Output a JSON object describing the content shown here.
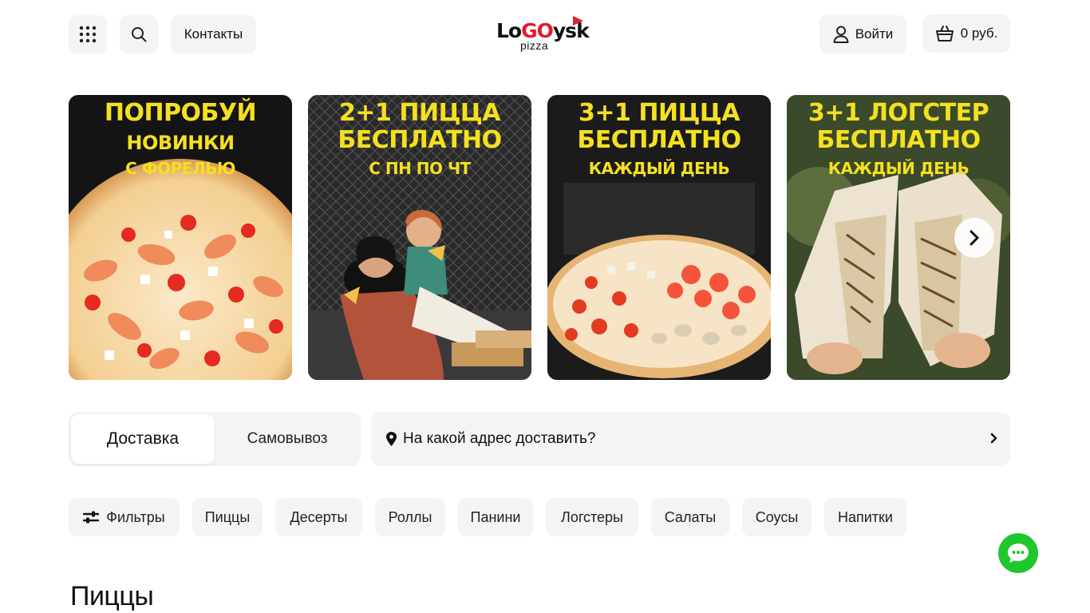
{
  "header": {
    "contacts_label": "Контакты",
    "logo": {
      "word_part1": "Lo",
      "word_part2": "GO",
      "word_part3": "ysk",
      "subtitle": "pizza"
    },
    "login_label": "Войти",
    "cart_label": "0 руб."
  },
  "banners": [
    {
      "line1": "ПОПРОБУЙ",
      "line2": "НОВИНКИ",
      "line3": "С ФОРЕЛЬЮ"
    },
    {
      "line1": "2+1 ПИЦЦА",
      "line2": "БЕСПЛАТНО",
      "line3": "С ПН ПО ЧТ"
    },
    {
      "line1": "3+1 ПИЦЦА",
      "line2": "БЕСПЛАТНО",
      "line3": "КАЖДЫЙ ДЕНЬ"
    },
    {
      "line1": "3+1 ЛОГСТЕР",
      "line2": "БЕСПЛАТНО",
      "line3": "КАЖДЫЙ ДЕНЬ"
    }
  ],
  "delivery": {
    "tab_delivery": "Доставка",
    "tab_pickup": "Самовывоз",
    "address_prompt": "На какой адрес доставить?"
  },
  "categories": {
    "filters_label": "Фильтры",
    "items": [
      "Пиццы",
      "Десерты",
      "Роллы",
      "Панини",
      "Логстеры",
      "Салаты",
      "Соусы",
      "Напитки"
    ]
  },
  "section_title": "Пиццы",
  "colors": {
    "accent_yellow": "#f5e020",
    "logo_red": "#e11d2c",
    "chat_green": "#1ec72d",
    "chip_bg": "#f4f4f4"
  }
}
